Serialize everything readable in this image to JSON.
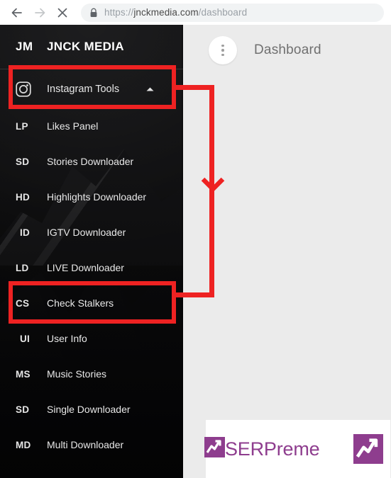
{
  "browser": {
    "back_icon": "back-arrow-icon",
    "forward_icon": "forward-arrow-icon",
    "stop_icon": "stop-x-icon",
    "lock_icon": "lock-icon",
    "url_scheme": "https://",
    "url_host": "jnckmedia.com",
    "url_path": "/dashboard"
  },
  "sidebar": {
    "brand": {
      "initials": "JM",
      "name": "JNCK MEDIA"
    },
    "section": {
      "icon": "instagram-icon",
      "label": "Instagram Tools",
      "chevron": "chevron-up-icon",
      "expanded": true
    },
    "items": [
      {
        "abbr": "LP",
        "label": "Likes Panel"
      },
      {
        "abbr": "SD",
        "label": "Stories Downloader"
      },
      {
        "abbr": "HD",
        "label": "Highlights Downloader"
      },
      {
        "abbr": "ID",
        "label": "IGTV Downloader"
      },
      {
        "abbr": "LD",
        "label": "LIVE Downloader"
      },
      {
        "abbr": "CS",
        "label": "Check Stalkers"
      },
      {
        "abbr": "UI",
        "label": "User Info"
      },
      {
        "abbr": "MS",
        "label": "Music Stories"
      },
      {
        "abbr": "SD",
        "label": "Single Downloader"
      },
      {
        "abbr": "MD",
        "label": "Multi Downloader"
      }
    ]
  },
  "main": {
    "menu_button_icon": "vertical-dots-icon",
    "page_title": "Dashboard",
    "serpreme": {
      "wordmark": "SERPreme",
      "logo_icon": "serpreme-chart-logo-icon",
      "secondary_icon": "serpreme-chart-logo-icon"
    }
  },
  "annotations": {
    "highlight_1": "Instagram Tools",
    "highlight_2": "Check Stalkers",
    "arrow": "down-arrow-annotation",
    "color": "#ee2222"
  },
  "colors": {
    "sidebar_bg": "#0a0a0a",
    "content_bg": "#ebebeb",
    "annotation_red": "#ee2222",
    "serpreme_purple": "#8e3d8e",
    "title_gray": "#707070"
  }
}
